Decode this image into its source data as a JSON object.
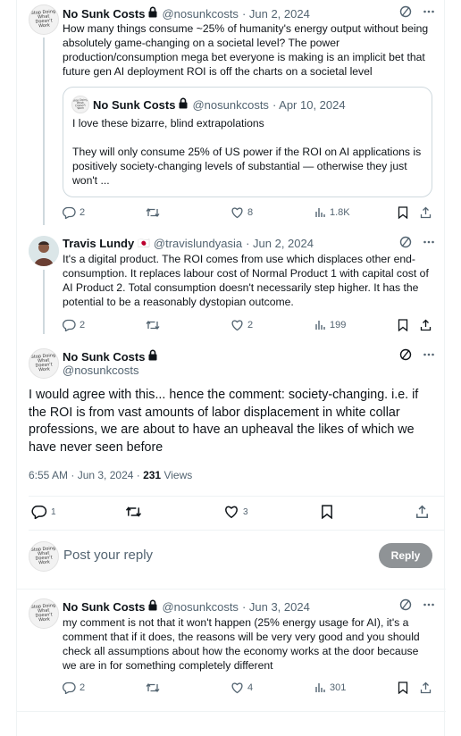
{
  "avatar_text": "Stop Doing What Doesn't Work",
  "tweet1": {
    "name": "No Sunk Costs",
    "handle": "@nosunkcosts",
    "date": "· Jun 2, 2024",
    "text": "How many things consume ~25% of humanity's energy output without being absolutely game-changing on a societal level? The power production/consumption mega bet everyone is making is an implicit bet that future gen AI deployment ROI is off the charts on a societal level",
    "quote": {
      "name": "No Sunk Costs",
      "handle": "@nosunkcosts",
      "date": "· Apr 10, 2024",
      "line1": "I love these bizarre, blind extrapolations",
      "line2": "They will only consume 25% of US power if the ROI on AI applications is positively society-changing levels of substantial — otherwise they just won't ..."
    },
    "replies": "2",
    "retweets": "",
    "likes": "8",
    "views": "1.8K"
  },
  "tweet2": {
    "name": "Travis Lundy",
    "badge": "🇯🇵",
    "handle": "@travislundyasia",
    "date": "· Jun 2, 2024",
    "text": "It's a digital product. The ROI comes from use which displaces other end-consumption. It replaces labour cost of Normal Product 1 with capital cost of AI Product 2. Total consumption doesn't necessarily step higher. It has the potential to be a reasonably dystopian outcome.",
    "replies": "2",
    "retweets": "",
    "likes": "2",
    "views": "199"
  },
  "main_tweet": {
    "name": "No Sunk Costs",
    "handle": "@nosunkcosts",
    "text": "I would agree with this... hence the comment: society-changing. i.e. if the ROI is from vast amounts of labor displacement in white collar professions, we are about to have an upheaval the likes of which we have never seen before",
    "time": "6:55 AM · Jun 3, 2024 · ",
    "views_count": "231",
    "views_label": " Views",
    "replies": "1",
    "retweets": "",
    "likes": "3"
  },
  "compose": {
    "placeholder": "Post your reply",
    "button": "Reply"
  },
  "tweet3": {
    "name": "No Sunk Costs",
    "handle": "@nosunkcosts",
    "date": "· Jun 3, 2024",
    "text": "my comment is not that it won't happen (25% energy usage for AI), it's a comment that if it does, the reasons will be very very good and you should check all assumptions about how the economy works at the door because we are in for something completely different",
    "replies": "2",
    "retweets": "",
    "likes": "4",
    "views": "301"
  },
  "colors": {
    "text": "#0f1419",
    "muted": "#536471",
    "border": "#eff3f4",
    "reply_button": "#8f9396"
  }
}
